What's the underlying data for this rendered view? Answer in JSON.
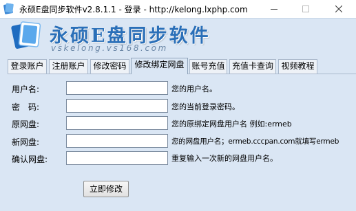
{
  "window": {
    "title": "永硕E盘同步软件v2.8.1.1 - 登录 - http://kelong.lxphp.com"
  },
  "banner": {
    "title": "永硕E盘同步软件",
    "subtitle": "vskelong.vs168.com"
  },
  "tabs": [
    {
      "label": "登录账户",
      "active": false
    },
    {
      "label": "注册账户",
      "active": false
    },
    {
      "label": "修改密码",
      "active": false
    },
    {
      "label": "修改绑定网盘",
      "active": true
    },
    {
      "label": "账号充值",
      "active": false
    },
    {
      "label": "充值卡查询",
      "active": false
    },
    {
      "label": "视频教程",
      "active": false
    }
  ],
  "form": {
    "fields": [
      {
        "label": "用户名:",
        "value": "",
        "hint": "您的用户名。"
      },
      {
        "label": "密　码:",
        "value": "",
        "hint": "您的当前登录密码。"
      },
      {
        "label": "原网盘:",
        "value": "",
        "hint": "您的原绑定网盘用户名 例如:ermeb"
      },
      {
        "label": "新网盘:",
        "value": "",
        "hint": "您的网盘用户名；ermeb.cccpan.com就填写ermeb"
      },
      {
        "label": "确认网盘:",
        "value": "",
        "hint": "重复输入一次新的网盘用户名。"
      }
    ],
    "submit_label": "立即修改"
  },
  "colors": {
    "client_bg": "#dae6f4",
    "brand_blue": "#2a6fb8"
  },
  "icons": {
    "app": "app-logo-icon",
    "minimize": "minimize-icon",
    "maximize": "maximize-icon",
    "close": "close-icon"
  }
}
